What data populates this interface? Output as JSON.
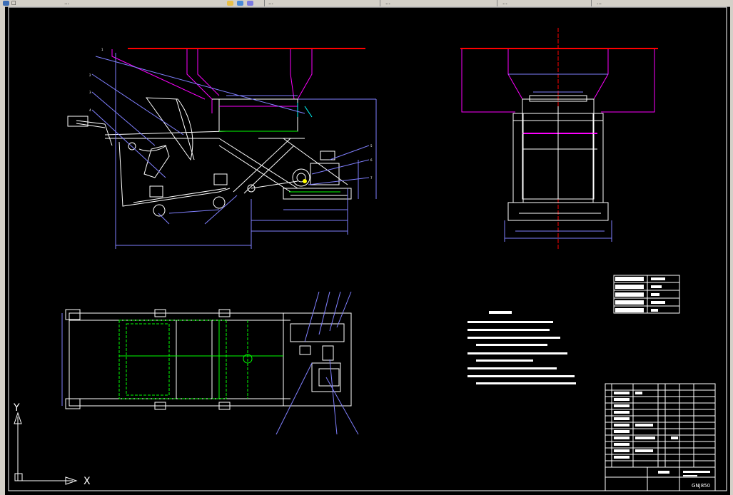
{
  "toolbar": {
    "items": [
      "□",
      "…",
      "…",
      "…",
      "…",
      "…"
    ]
  },
  "drawing": {
    "drawing_number": "GNJ850",
    "ucs_x_label": "X",
    "ucs_y_label": "Y",
    "colors": {
      "background": "#000000",
      "frame": "#ffffff",
      "outline": "#ffffff",
      "hopper": "#ff00ff",
      "dimension": "#8080ff",
      "leader": "#8080ff",
      "center_line": "#ff0000",
      "hidden": "#00ff00",
      "highlight": "#ff00ff",
      "yellow": "#ffff00",
      "cyan": "#00ffff",
      "gray": "#808080"
    },
    "views": [
      "front-view",
      "side-view",
      "top-view"
    ]
  }
}
